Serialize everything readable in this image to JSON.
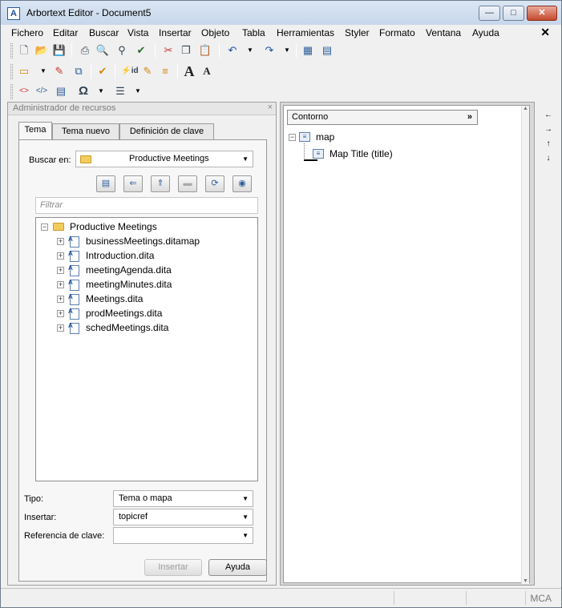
{
  "window": {
    "title": "Arbortext Editor - Document5",
    "app_icon": "arbortext-logo-icon"
  },
  "window_controls": {
    "minimize": "—",
    "maximize": "□",
    "close": "✕"
  },
  "menubar": {
    "items": [
      "Fichero",
      "Editar",
      "Buscar",
      "Vista",
      "Insertar",
      "Objeto",
      "Tabla",
      "Herramientas",
      "Styler",
      "Formato",
      "Ventana",
      "Ayuda"
    ],
    "close_glyph": "✕"
  },
  "toolbar1": [
    "new-document-icon",
    "open-icon",
    "save-icon",
    "print-icon",
    "print-preview-icon",
    "find-icon",
    "spell-check-icon",
    "cut-icon",
    "copy-icon",
    "paste-icon",
    "undo-icon",
    "redo-icon",
    "table-icon",
    "outline-view-icon"
  ],
  "toolbar2": [
    "insert-markup-icon",
    "change-markup-icon",
    "split-icon",
    "check-completeness-icon",
    "insert-id-icon",
    "modify-attributes-icon",
    "increase-font-icon",
    "decrease-font-icon"
  ],
  "toolbar3": [
    "xref-icon",
    "insert-link-icon",
    "insert-resource-icon",
    "special-character-icon",
    "list-format-icon"
  ],
  "resource_manager": {
    "header": "Administrador de recursos",
    "close_glyph": "×",
    "tabs": [
      "Tema",
      "Tema nuevo",
      "Definición de clave"
    ],
    "search_label": "Buscar en:",
    "search_value": "Productive Meetings",
    "filter_placeholder": "Filtrar",
    "toolbar_buttons": [
      "view-list-icon",
      "back-icon",
      "up-folder-icon",
      "folder-icon",
      "refresh-icon",
      "web-browse-icon"
    ],
    "tree": {
      "root": "Productive Meetings",
      "items": [
        "businessMeetings.ditamap",
        "Introduction.dita",
        "meetingAgenda.dita",
        "meetingMinutes.dita",
        "Meetings.dita",
        "prodMeetings.dita",
        "schedMeetings.dita"
      ]
    },
    "tipo_label": "Tipo:",
    "tipo_value": "Tema o mapa",
    "insertar_label": "Insertar:",
    "insertar_value": "topicref",
    "ref_label": "Referencia de clave:",
    "ref_value": "",
    "insert_button": "Insertar",
    "help_button": "Ayuda"
  },
  "outline": {
    "header": "Contorno",
    "header_chevron": "»",
    "root": "map",
    "child": "Map Title (title)"
  },
  "nav_arrows": [
    "←",
    "→",
    "↑",
    "↓"
  ],
  "status": {
    "mode": "MCA"
  }
}
